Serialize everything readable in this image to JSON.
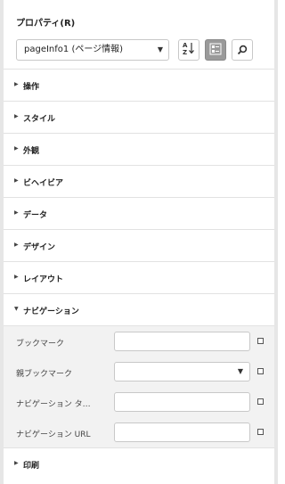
{
  "panel": {
    "title": "プロパティ(R)",
    "selector_value": "pageInfo1 (ページ情報)",
    "icons": {
      "sort": "sort-az-icon",
      "categorize": "category-view-icon",
      "search": "search-icon"
    }
  },
  "sections": [
    {
      "label": "操作"
    },
    {
      "label": "スタイル"
    },
    {
      "label": "外観"
    },
    {
      "label": "ビヘイビア"
    },
    {
      "label": "データ"
    },
    {
      "label": "デザイン"
    },
    {
      "label": "レイアウト"
    },
    {
      "label": "ナビゲーション"
    },
    {
      "label": "印刷"
    }
  ],
  "navigation_props": [
    {
      "label": "ブックマーク",
      "value": ""
    },
    {
      "label": "親ブックマーク",
      "value": ""
    },
    {
      "label": "ナビゲーション タ…",
      "value": ""
    },
    {
      "label": "ナビゲーション URL",
      "value": ""
    }
  ]
}
